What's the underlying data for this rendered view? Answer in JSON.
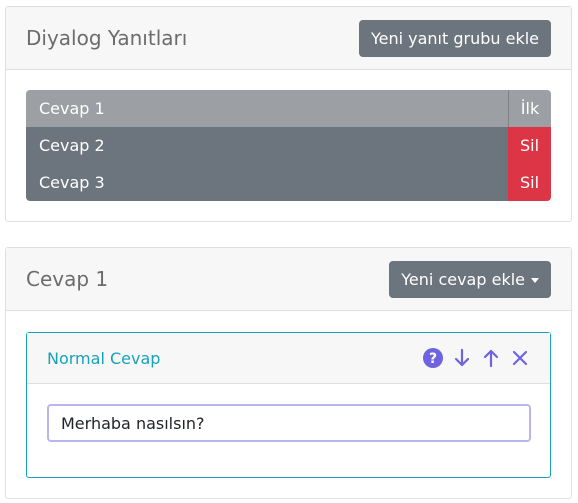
{
  "dialog_card": {
    "title": "Diyalog Yanıtları",
    "add_group_button": "Yeni yanıt grubu ekle",
    "answers": [
      {
        "label": "Cevap 1",
        "action": "İlk"
      },
      {
        "label": "Cevap 2",
        "action": "Sil"
      },
      {
        "label": "Cevap 3",
        "action": "Sil"
      }
    ]
  },
  "answer_card": {
    "title": "Cevap 1",
    "add_answer_button": "Yeni cevap ekle",
    "response": {
      "type_label": "Normal Cevap",
      "text_value": "Merhaba nasılsın?",
      "icons": [
        "help-icon",
        "arrow-down-icon",
        "arrow-up-icon",
        "close-icon"
      ]
    }
  },
  "colors": {
    "accent": "#17a2b8",
    "danger": "#dc3545",
    "secondary": "#6c757d",
    "icon": "#6f63e0"
  }
}
